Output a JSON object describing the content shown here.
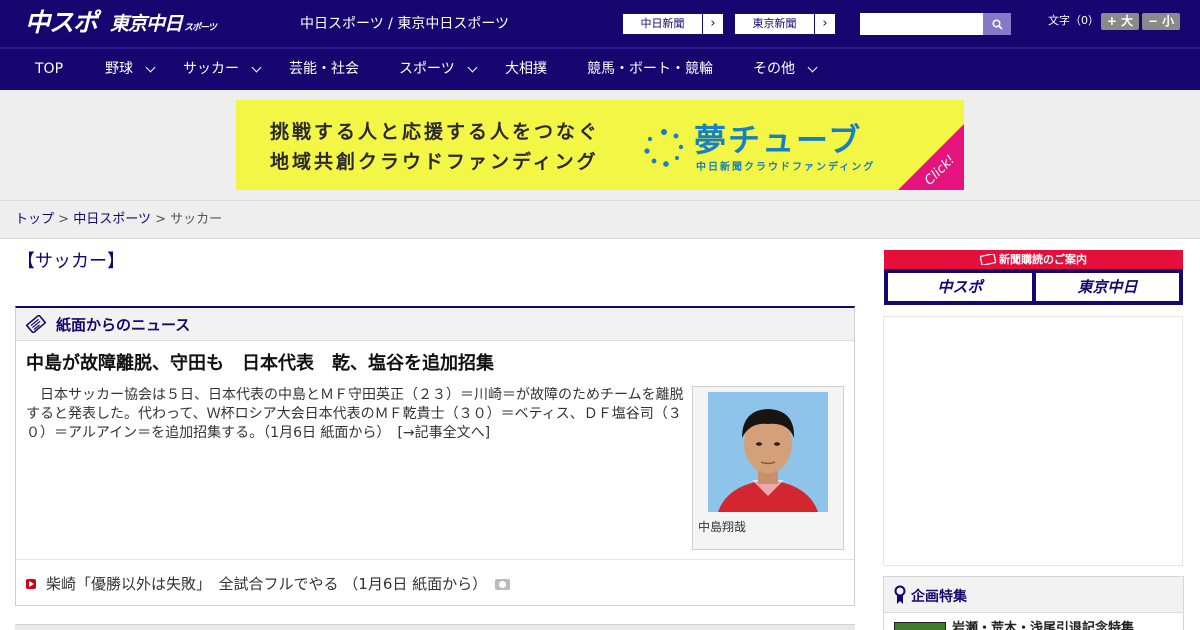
{
  "header": {
    "logo_main": "中スポ",
    "logo_secondary": "東京中日",
    "logo_secondary_small": "スポーツ",
    "tagline": "中日スポーツ / 東京中日スポーツ",
    "news_links": [
      {
        "label": "中日新聞"
      },
      {
        "label": "東京新聞"
      }
    ],
    "search": {
      "value": "",
      "placeholder": ""
    },
    "fontsize_label": "文字（0）",
    "fontsize_up": "+ 大",
    "fontsize_down": "− 小"
  },
  "nav": [
    {
      "label": "TOP",
      "has_dropdown": false
    },
    {
      "label": "野球",
      "has_dropdown": true
    },
    {
      "label": "サッカー",
      "has_dropdown": true
    },
    {
      "label": "芸能・社会",
      "has_dropdown": false
    },
    {
      "label": "スポーツ",
      "has_dropdown": true
    },
    {
      "label": "大相撲",
      "has_dropdown": false
    },
    {
      "label": "競馬・ボート・競輪",
      "has_dropdown": false
    },
    {
      "label": "その他",
      "has_dropdown": true
    }
  ],
  "banner": {
    "line1": "挑戦する人と応援する人をつなぐ",
    "line2": "地域共創クラウドファンディング",
    "brand": "夢チューブ",
    "brand_sub": "中日新聞クラウドファンディング",
    "click": "Click!"
  },
  "breadcrumb": {
    "home": "トップ",
    "section": "中日スポーツ",
    "current": "サッカー",
    "separator": ">"
  },
  "page_title": "【サッカー】",
  "news": {
    "heading": "紙面からのニュース",
    "article": {
      "title": "中島が故障離脱、守田も　日本代表　乾、塩谷を追加招集",
      "body": "日本サッカー協会は５日、日本代表の中島とＭＦ守田英正（２３）＝川崎＝が故障のためチームを離脱すると発表した。代わって、Ｗ杯ロシア大会日本代表のＭＦ乾貴士（３０）＝ベティス、ＤＦ塩谷司（３０）＝アルアイン＝を追加招集する。（1月6日 紙面から）",
      "more": "[→記事全文へ]",
      "photo_caption": "中島翔哉"
    },
    "sub_items": [
      {
        "text": "柴崎「優勝以外は失敗」　全試合フルでやる （1月6日 紙面から）",
        "has_photo": true
      }
    ]
  },
  "sidebar": {
    "subscription": {
      "heading": "新聞購読のご案内",
      "buttons": [
        {
          "label": "中スポ"
        },
        {
          "label": "東京中日"
        }
      ]
    },
    "feature": {
      "heading": "企画特集",
      "items": [
        {
          "text": "岩瀬・荒木・浅尾引退記念特集"
        }
      ]
    }
  },
  "colors": {
    "brand_navy": "#17066f",
    "accent_red": "#e60f3c",
    "banner_yellow": "#f4f645",
    "banner_blue": "#1780c4",
    "click_pink": "#e4137e"
  }
}
